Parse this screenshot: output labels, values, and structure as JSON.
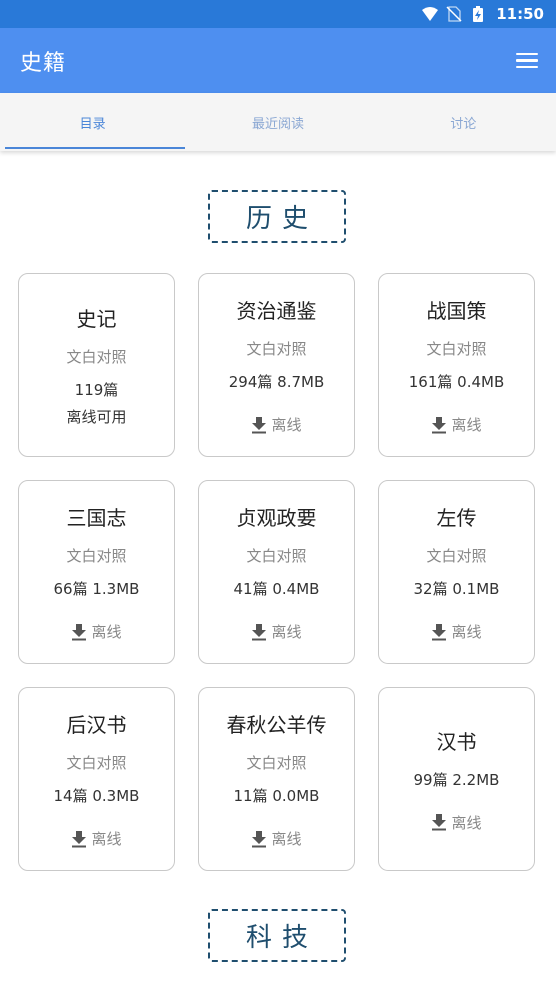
{
  "status_bar": {
    "time": "11:50"
  },
  "app_bar": {
    "title": "史籍"
  },
  "tabs": [
    {
      "label": "目录",
      "active": true
    },
    {
      "label": "最近阅读",
      "active": false
    },
    {
      "label": "讨论",
      "active": false
    }
  ],
  "sections": [
    {
      "title": "历史"
    },
    {
      "title": "科技"
    }
  ],
  "books": [
    {
      "title": "史记",
      "subtitle": "文白对照",
      "stats": "119篇",
      "status": "离线可用"
    },
    {
      "title": "资治通鉴",
      "subtitle": "文白对照",
      "stats": "294篇 8.7MB",
      "action": "离线"
    },
    {
      "title": "战国策",
      "subtitle": "文白对照",
      "stats": "161篇 0.4MB",
      "action": "离线"
    },
    {
      "title": "三国志",
      "subtitle": "文白对照",
      "stats": "66篇 1.3MB",
      "action": "离线"
    },
    {
      "title": "贞观政要",
      "subtitle": "文白对照",
      "stats": "41篇 0.4MB",
      "action": "离线"
    },
    {
      "title": "左传",
      "subtitle": "文白对照",
      "stats": "32篇 0.1MB",
      "action": "离线"
    },
    {
      "title": "后汉书",
      "subtitle": "文白对照",
      "stats": "14篇 0.3MB",
      "action": "离线"
    },
    {
      "title": "春秋公羊传",
      "subtitle": "文白对照",
      "stats": "11篇 0.0MB",
      "action": "离线"
    },
    {
      "title": "汉书",
      "subtitle": "",
      "stats": "99篇 2.2MB",
      "action": "离线"
    }
  ],
  "colors": {
    "status_bar": "#2979d8",
    "app_bar": "#4e8ff0",
    "tab_active": "#4a86d8",
    "section_border": "#1f4e6e"
  },
  "icons": {
    "wifi": "wifi-icon",
    "no_sim": "no-sim-icon",
    "battery": "battery-charging-icon",
    "menu": "menu-icon",
    "download": "download-icon"
  }
}
